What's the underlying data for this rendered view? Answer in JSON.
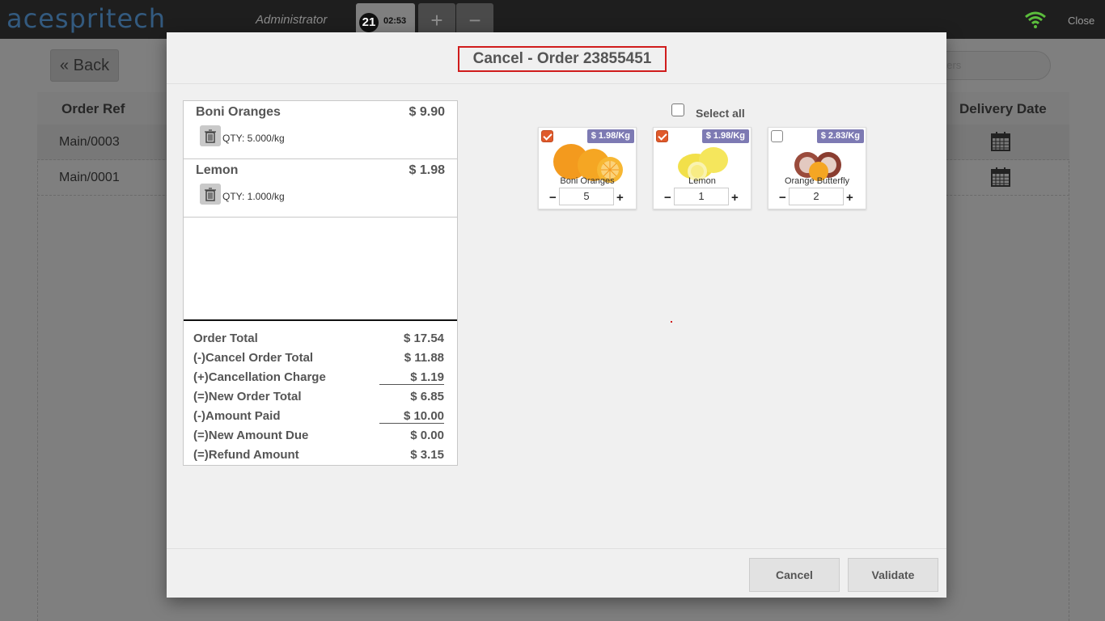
{
  "topbar": {
    "brand": "acespritech",
    "user": "Administrator",
    "order_tab": {
      "number": "21",
      "time": "02:53"
    },
    "add_tab": "+",
    "remove_tab": "−",
    "close_label": "Close",
    "wifi_icon": "wifi-icon"
  },
  "page": {
    "back_label": "Back",
    "search_placeholder": "ders",
    "columns": [
      "Order Ref",
      "Delivery Date"
    ],
    "rows": [
      {
        "ref": "Main/0003"
      },
      {
        "ref": "Main/0001"
      }
    ]
  },
  "modal": {
    "title": "Cancel - Order 23855451",
    "lines": [
      {
        "name": "Boni Oranges",
        "price": "$ 9.90",
        "qty": "QTY: 5.000/kg"
      },
      {
        "name": "Lemon",
        "price": "$ 1.98",
        "qty": "QTY: 1.000/kg"
      }
    ],
    "totals": [
      {
        "label": "Order Total",
        "value": "$ 17.54"
      },
      {
        "label": "(-)Cancel Order Total",
        "value": "$ 11.88"
      },
      {
        "label": "(+)Cancellation Charge",
        "value": "$ 1.19"
      },
      {
        "label": "(=)New Order Total",
        "value": "$ 6.85"
      },
      {
        "label": "(-)Amount Paid",
        "value": "$ 10.00"
      },
      {
        "label": "(=)New Amount Due",
        "value": "$ 0.00"
      },
      {
        "label": "(=)Refund Amount",
        "value": "$ 3.15"
      }
    ],
    "select_all_label": "Select all",
    "products": [
      {
        "name": "Boni Oranges",
        "price": "$ 1.98/Kg",
        "qty": "5",
        "checked": true
      },
      {
        "name": "Lemon",
        "price": "$ 1.98/Kg",
        "qty": "1",
        "checked": true
      },
      {
        "name": "Orange Butterfly",
        "price": "$ 2.83/Kg",
        "qty": "2",
        "checked": false
      }
    ],
    "minus": "−",
    "plus": "+",
    "cancel_label": "Cancel",
    "validate_label": "Validate"
  },
  "colors": {
    "accent_border": "#d01c1c",
    "price_tag": "#7d7ab3",
    "checkbox_checked": "#e05a2b"
  }
}
